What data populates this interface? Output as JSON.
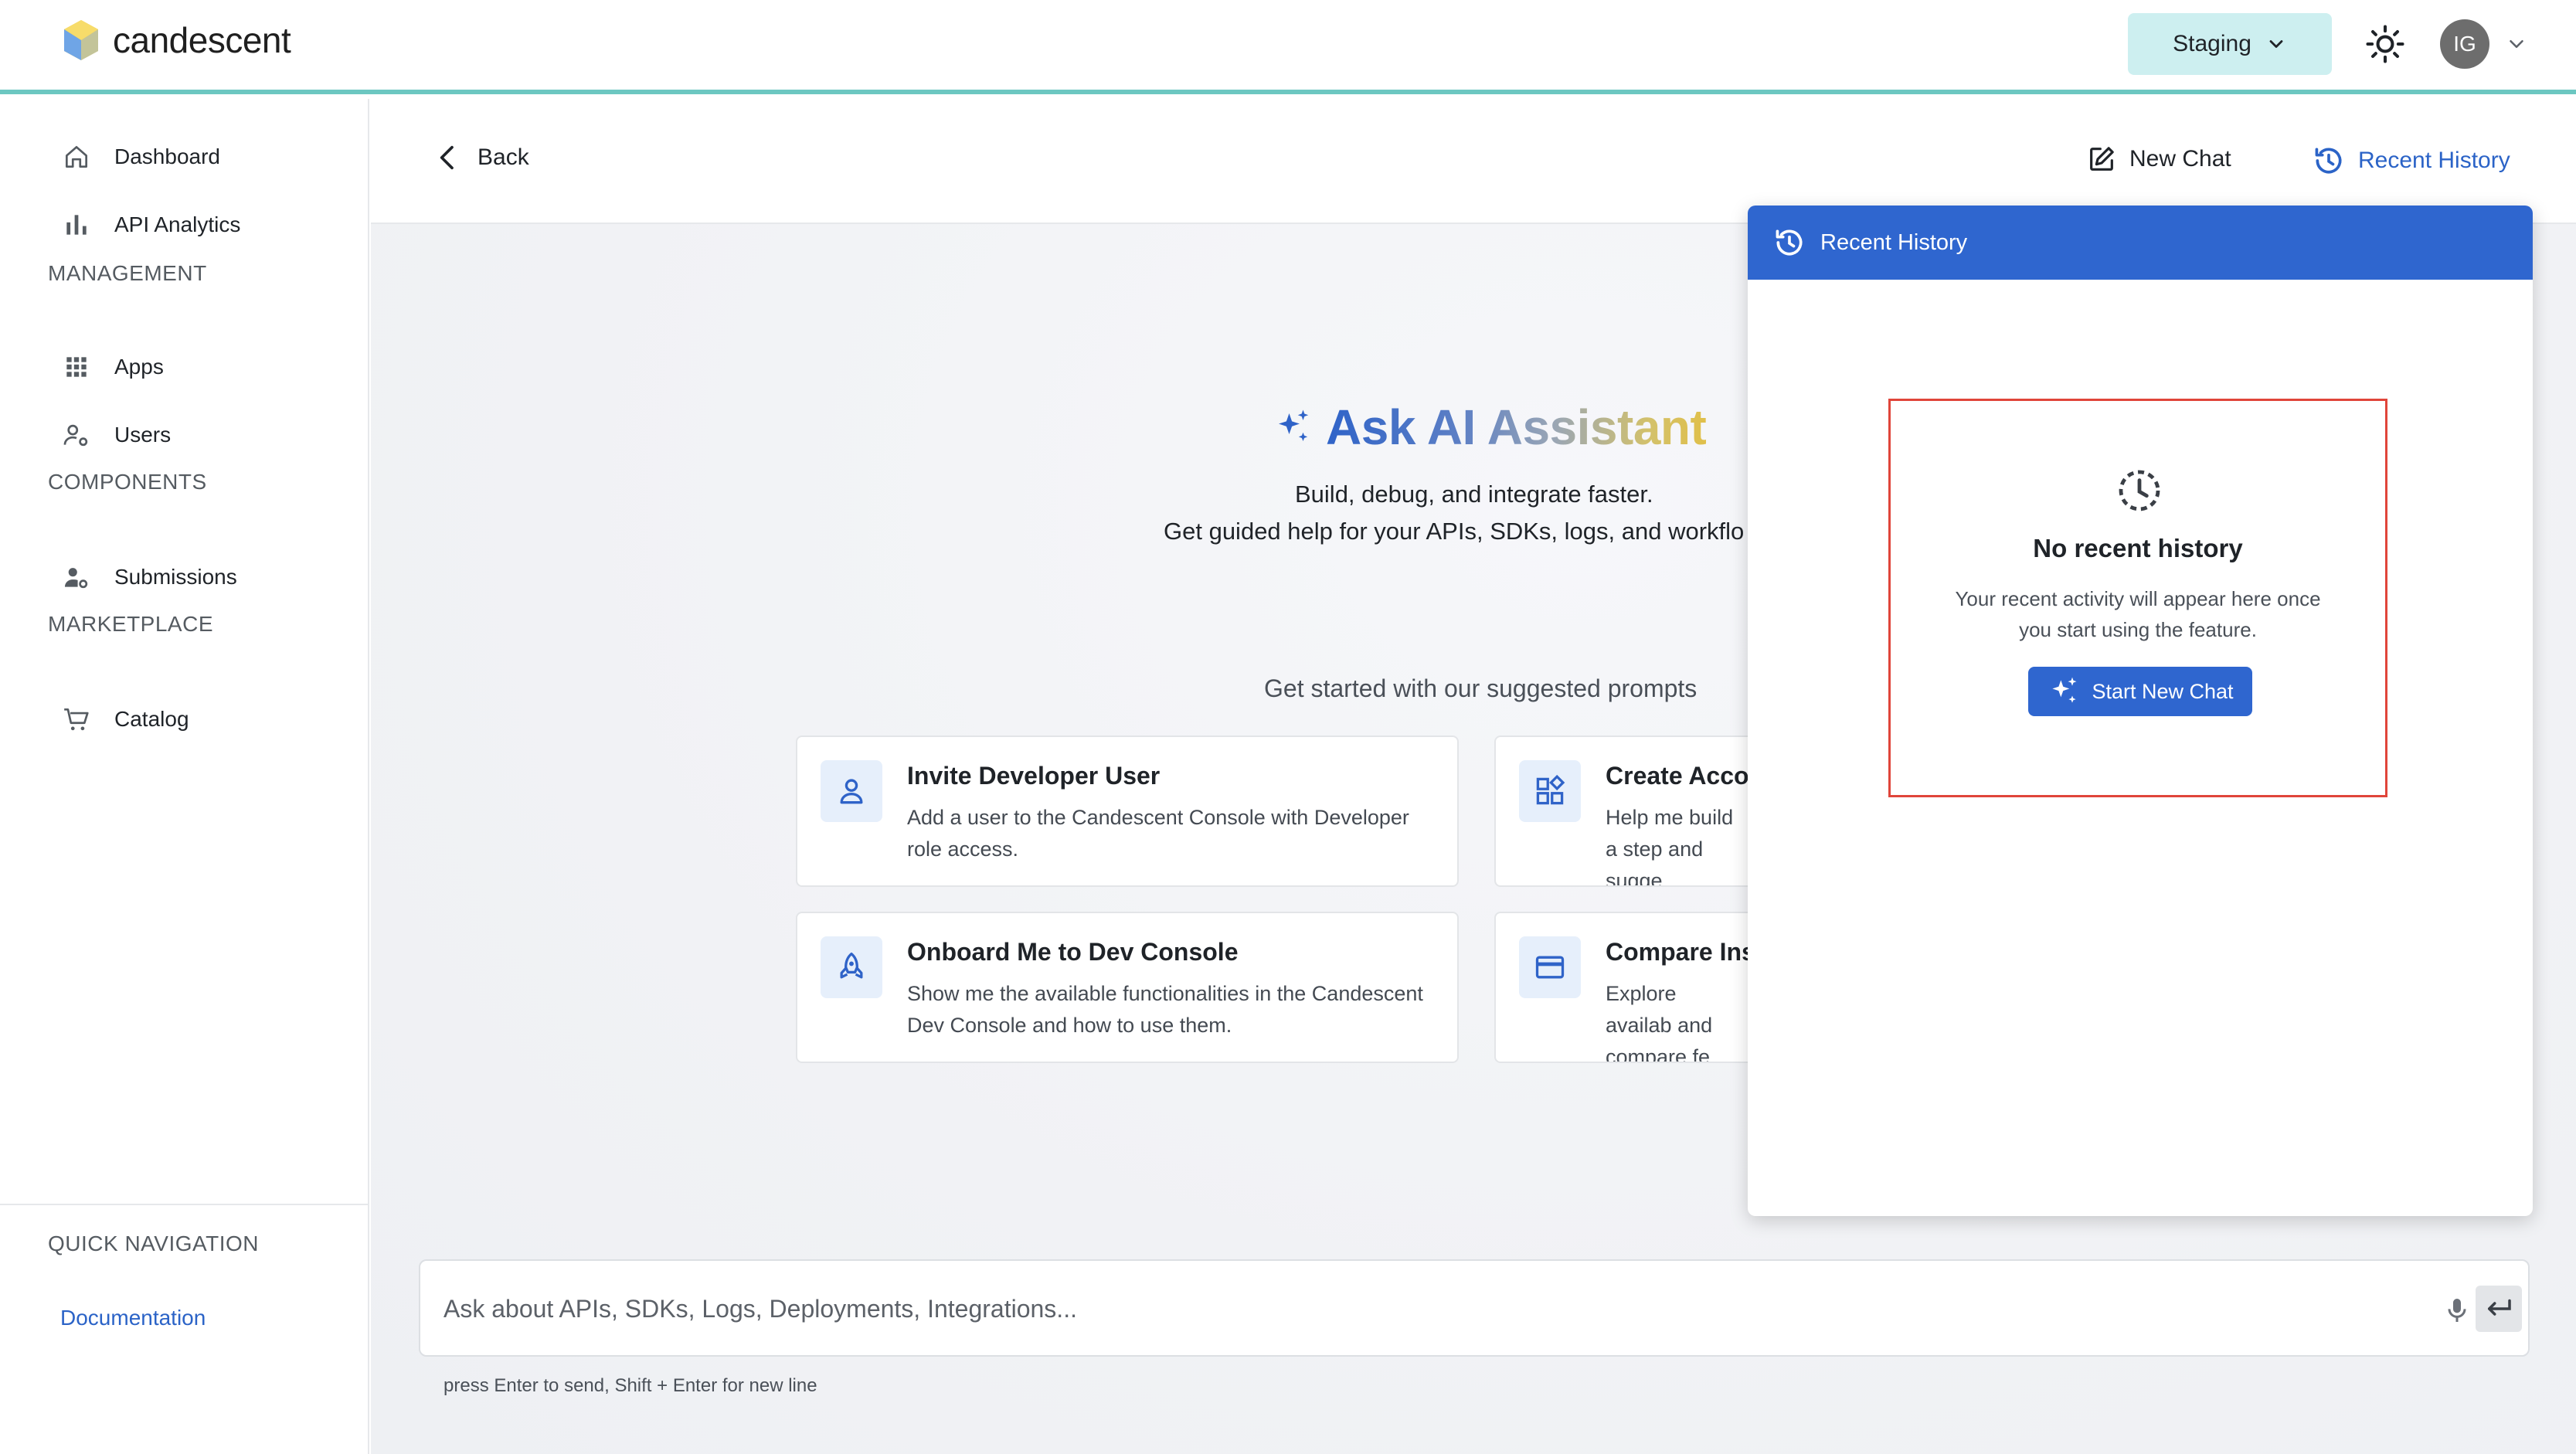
{
  "app": {
    "brand": "candescent",
    "environment": "Staging",
    "user_initials": "IG",
    "accent_color": "#2f66cf",
    "header_underline_color": "#6cc7c1"
  },
  "sidebar": {
    "top_items": [
      {
        "label": "Dashboard",
        "icon": "home-icon"
      },
      {
        "label": "API Analytics",
        "icon": "bar-chart-icon"
      }
    ],
    "sections": [
      {
        "title": "MANAGEMENT",
        "items": [
          {
            "label": "Apps",
            "icon": "grid-icon"
          },
          {
            "label": "Users",
            "icon": "users-gear-icon"
          }
        ]
      },
      {
        "title": "COMPONENTS",
        "items": [
          {
            "label": "Submissions",
            "icon": "submissions-icon"
          }
        ]
      },
      {
        "title": "MARKETPLACE",
        "items": [
          {
            "label": "Catalog",
            "icon": "cart-icon"
          }
        ]
      }
    ],
    "quick_nav": {
      "title": "QUICK NAVIGATION",
      "links": [
        {
          "label": "Documentation"
        }
      ]
    }
  },
  "toolbar": {
    "back_label": "Back",
    "new_chat_label": "New Chat",
    "recent_history_label": "Recent History"
  },
  "hero": {
    "title": "Ask AI Assistant",
    "subtitle_line1": "Build, debug, and integrate faster.",
    "subtitle_line2": "Get guided help for your APIs, SDKs, logs, and workflo"
  },
  "prompts": {
    "heading": "Get started with our suggested prompts",
    "cards": [
      {
        "title": "Invite Developer User",
        "desc": "Add a user to the Candescent Console with Developer role access.",
        "icon": "user-icon"
      },
      {
        "title": "Create Acco",
        "desc": "Help me build a step and sugge",
        "icon": "widgets-icon"
      },
      {
        "title": "Onboard Me to Dev Console",
        "desc": "Show me the available functionalities in the Candescent Dev Console and how to use them.",
        "icon": "rocket-icon"
      },
      {
        "title": "Compare Ins",
        "desc": "Explore availab and compare fe",
        "icon": "card-icon"
      }
    ]
  },
  "chat": {
    "placeholder": "Ask about APIs, SDKs, Logs, Deployments, Integrations...",
    "hint": "press Enter to send, Shift + Enter for new line"
  },
  "history_panel": {
    "title": "Recent History",
    "empty_title": "No recent history",
    "empty_desc": "Your recent activity will appear here once you start using the feature.",
    "start_button": "Start New Chat"
  }
}
